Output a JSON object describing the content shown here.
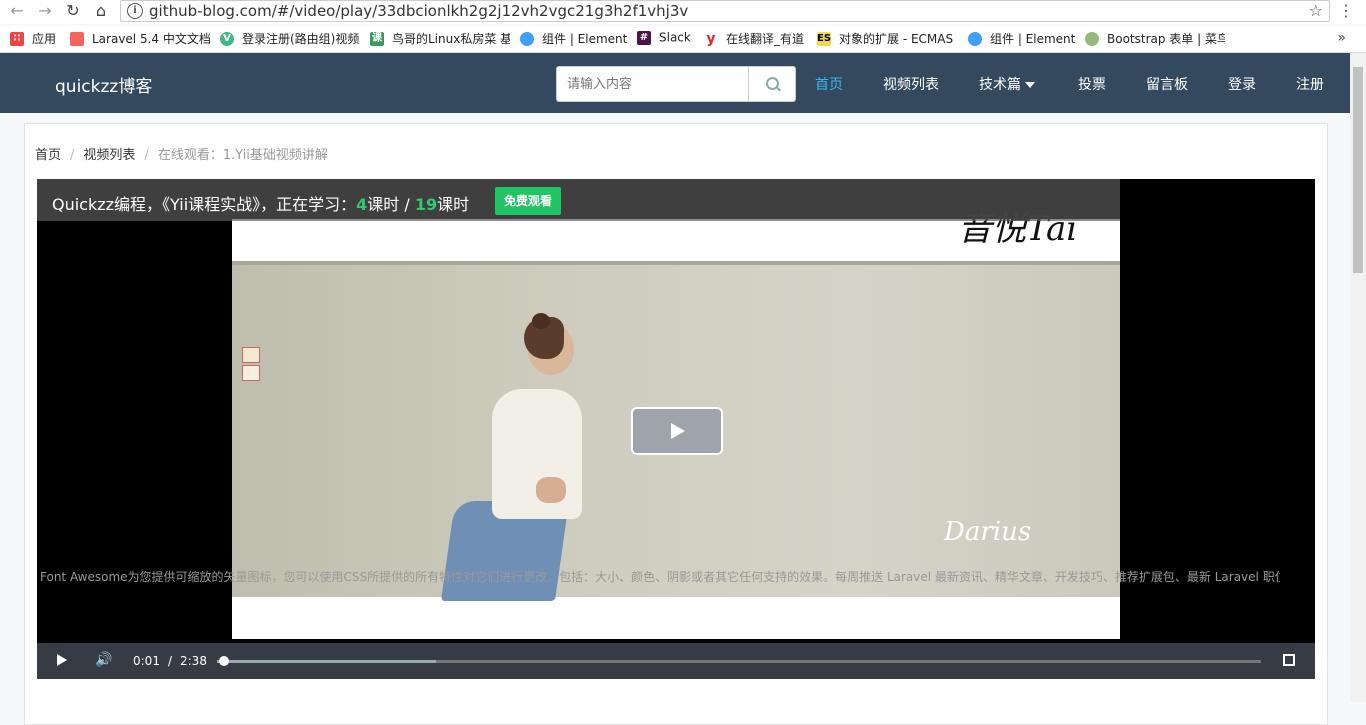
{
  "browser": {
    "url": "github-blog.com/#/video/play/33dbcionlkh2g2j12vh2vgc21g3h2f1vhj3v",
    "bookmarks": [
      {
        "label": "应用",
        "icon": "apps-grid-icon",
        "color": "#e44"
      },
      {
        "label": "Laravel 5.4 中文文档",
        "icon": "laravel-icon",
        "color": "#f4645f"
      },
      {
        "label": "登录注册(路由组)视频",
        "icon": "vue-icon",
        "color": "#41b883"
      },
      {
        "label": "鸟哥的Linux私房菜 基",
        "icon": "course-icon",
        "color": "#3c9a5f"
      },
      {
        "label": "组件 | Element",
        "icon": "element-icon",
        "color": "#409eff"
      },
      {
        "label": "Slack",
        "icon": "slack-icon",
        "color": "#4a154b"
      },
      {
        "label": "在线翻译_有道",
        "icon": "youdao-icon",
        "color": "#e22"
      },
      {
        "label": "对象的扩展 - ECMAS",
        "icon": "es-icon",
        "color": "#f0db4f"
      },
      {
        "label": "组件 | Element",
        "icon": "element-icon",
        "color": "#409eff"
      },
      {
        "label": "Bootstrap 表单 | 菜鸟",
        "icon": "runoob-icon",
        "color": "#96b97d"
      }
    ]
  },
  "navbar": {
    "brand": "quickzz博客",
    "search_placeholder": "请输入内容",
    "links": {
      "home": "首页",
      "videos": "视频列表",
      "tech": "技术篇",
      "vote": "投票",
      "board": "留言板",
      "login": "登录",
      "register": "注册"
    }
  },
  "breadcrumb": {
    "home": "首页",
    "videos": "视频列表",
    "current": "在线观看：1.Yii基础视频讲解"
  },
  "video": {
    "title_prefix": "Quickzz编程，《Yii课程实战》，正在学习：",
    "current_lesson": "4",
    "lesson_unit": "课时 / ",
    "total_lessons": "19",
    "total_unit": "课时",
    "free_button": "免费观看",
    "watermark_top": "音悦Tai",
    "watermark_bottom": "Darius",
    "current_time": "0:01",
    "separator": "/",
    "duration": "2:38",
    "progress": 0.006,
    "buffered": 0.21
  },
  "description": "Font Awesome为您提供可缩放的矢量图标，您可以使用CSS所提供的所有特性对它们进行更改，包括：大小、颜色、阴影或者其它任何支持的效果。每周推送 Laravel 最新资讯、精华文章、开发技巧、推荐扩展包、最新 Laravel 职位"
}
